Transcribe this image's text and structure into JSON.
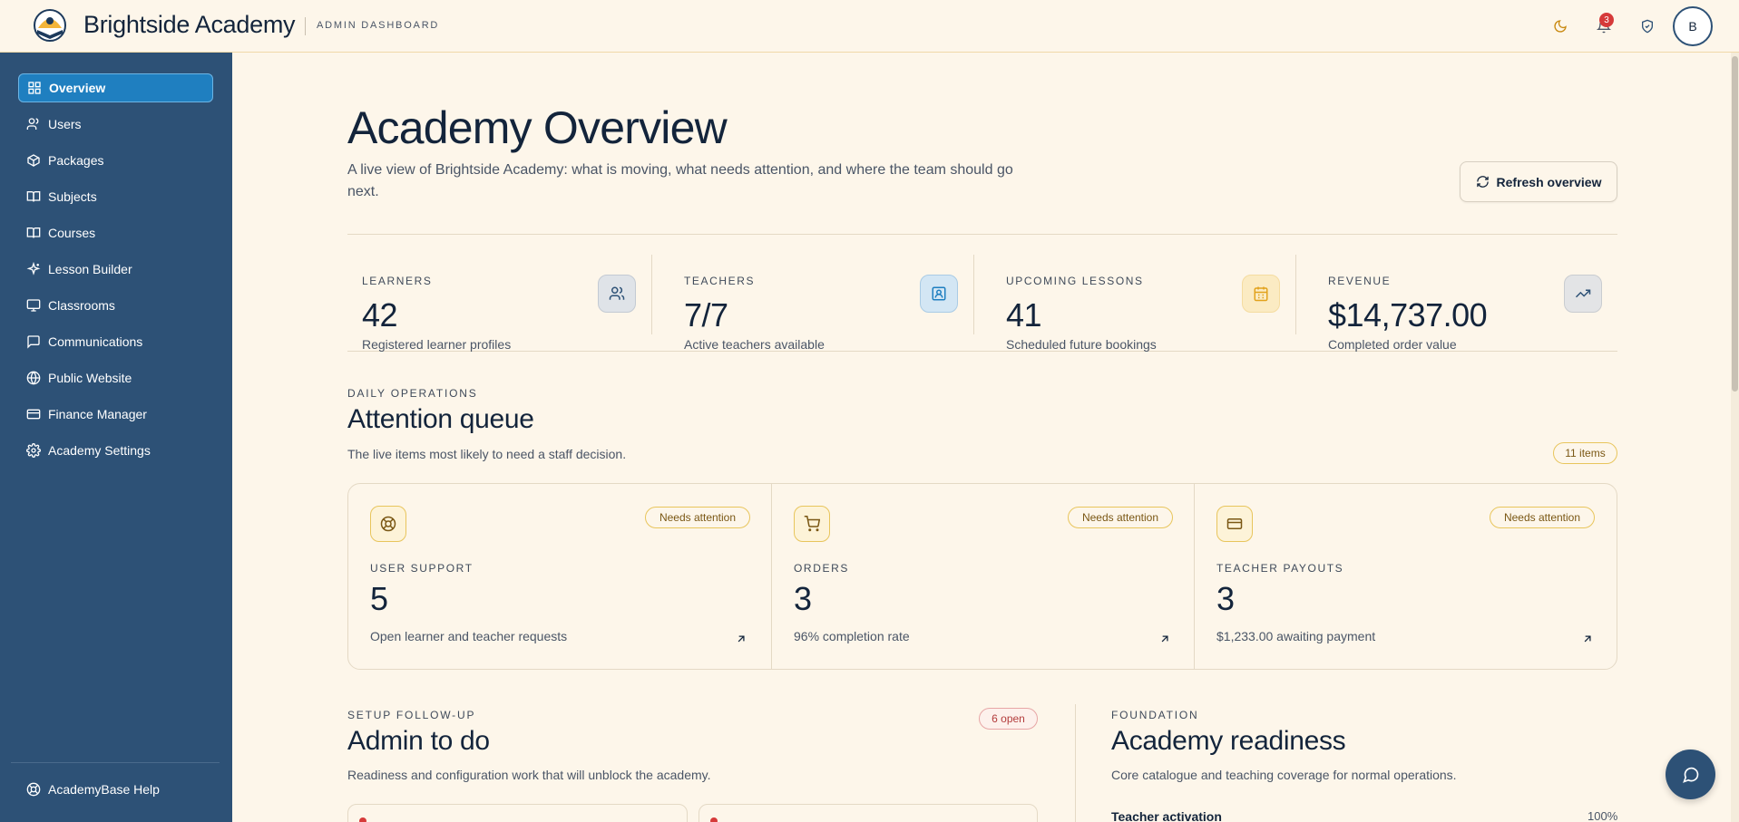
{
  "header": {
    "brand": "Brightside Academy",
    "subtitle": "ADMIN DASHBOARD",
    "notification_count": "3",
    "avatar_initial": "B"
  },
  "sidebar": {
    "items": [
      {
        "label": "Overview",
        "icon": "grid-icon",
        "active": true
      },
      {
        "label": "Users",
        "icon": "users-icon"
      },
      {
        "label": "Packages",
        "icon": "package-icon"
      },
      {
        "label": "Subjects",
        "icon": "book-icon"
      },
      {
        "label": "Courses",
        "icon": "book-open-icon"
      },
      {
        "label": "Lesson Builder",
        "icon": "sparkle-icon"
      },
      {
        "label": "Classrooms",
        "icon": "monitor-icon"
      },
      {
        "label": "Communications",
        "icon": "message-icon"
      },
      {
        "label": "Public Website",
        "icon": "globe-icon"
      },
      {
        "label": "Finance Manager",
        "icon": "wallet-icon"
      },
      {
        "label": "Academy Settings",
        "icon": "gear-icon"
      }
    ],
    "help_label": "AcademyBase Help"
  },
  "page": {
    "title": "Academy Overview",
    "description": "A live view of Brightside Academy: what is moving, what needs attention, and where the team should go next.",
    "refresh_label": "Refresh overview"
  },
  "stats": [
    {
      "label": "LEARNERS",
      "value": "42",
      "desc": "Registered learner profiles",
      "icon": "users-icon",
      "accent": "#dfe3e8"
    },
    {
      "label": "TEACHERS",
      "value": "7/7",
      "desc": "Active teachers available",
      "icon": "id-badge-icon",
      "accent": "#d3e6f4"
    },
    {
      "label": "UPCOMING LESSONS",
      "value": "41",
      "desc": "Scheduled future bookings",
      "icon": "calendar-icon",
      "accent": "#fbebc3"
    },
    {
      "label": "REVENUE",
      "value": "$14,737.00",
      "desc": "Completed order value",
      "icon": "trending-up-icon",
      "accent": "#e3e4e6"
    }
  ],
  "attention": {
    "eyebrow": "DAILY OPERATIONS",
    "title": "Attention queue",
    "desc": "The live items most likely to need a staff decision.",
    "count": "11 items",
    "cards": [
      {
        "label": "USER SUPPORT",
        "value": "5",
        "desc": "Open learner and teacher requests",
        "status": "Needs attention",
        "icon": "lifebuoy-icon"
      },
      {
        "label": "ORDERS",
        "value": "3",
        "desc": "96% completion rate",
        "status": "Needs attention",
        "icon": "cart-icon"
      },
      {
        "label": "TEACHER PAYOUTS",
        "value": "3",
        "desc": "$1,233.00 awaiting payment",
        "status": "Needs attention",
        "icon": "credit-card-icon"
      }
    ]
  },
  "admin_todo": {
    "eyebrow": "SETUP FOLLOW-UP",
    "title": "Admin to do",
    "desc": "Readiness and configuration work that will unblock the academy.",
    "count": "6 open"
  },
  "readiness": {
    "eyebrow": "FOUNDATION",
    "title": "Academy readiness",
    "desc": "Core catalogue and teaching coverage for normal operations.",
    "first_metric_label": "Teacher activation",
    "first_metric_value": "100%"
  },
  "colors": {
    "sidebar": "#2d5176",
    "active": "#1f7fc0",
    "background": "#fdf6ea",
    "warning": "#e8c55c",
    "danger": "#d63a3a"
  }
}
